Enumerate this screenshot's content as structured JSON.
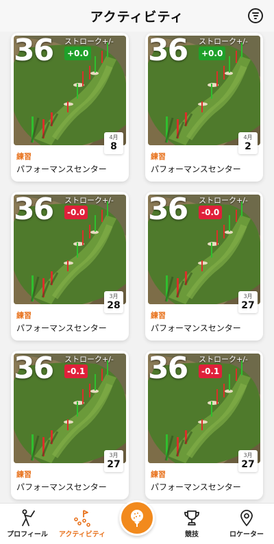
{
  "header": {
    "title": "アクティビティ",
    "menu_icon": "menu-circle-icon"
  },
  "stroke_label": "ストローク+/-",
  "cards": [
    {
      "score": "36",
      "diff": "+0.0",
      "diff_color": "#1fa02a",
      "month": "4月",
      "day": "8",
      "type": "練習",
      "venue": "パフォーマンスセンター"
    },
    {
      "score": "36",
      "diff": "+0.0",
      "diff_color": "#1fa02a",
      "month": "4月",
      "day": "2",
      "type": "練習",
      "venue": "パフォーマンスセンター"
    },
    {
      "score": "36",
      "diff": "-0.0",
      "diff_color": "#e0203a",
      "month": "3月",
      "day": "28",
      "type": "練習",
      "venue": "パフォーマンスセンター"
    },
    {
      "score": "36",
      "diff": "-0.0",
      "diff_color": "#e0203a",
      "month": "3月",
      "day": "27",
      "type": "練習",
      "venue": "パフォーマンスセンター"
    },
    {
      "score": "36",
      "diff": "-0.1",
      "diff_color": "#e0203a",
      "month": "3月",
      "day": "27",
      "type": "練習",
      "venue": "パフォーマンスセンター"
    },
    {
      "score": "36",
      "diff": "-0.1",
      "diff_color": "#e0203a",
      "month": "3月",
      "day": "27",
      "type": "練習",
      "venue": "パフォーマンスセンター"
    }
  ],
  "nav": {
    "profile": {
      "label": "プロフィール",
      "icon": "golfer-icon"
    },
    "activity": {
      "label": "アクティビティ",
      "icon": "activity-icon"
    },
    "play": {
      "icon": "golf-ball-tee-icon"
    },
    "compete": {
      "label": "競技",
      "icon": "trophy-icon"
    },
    "locator": {
      "label": "ロケーター",
      "icon": "location-pin-icon"
    }
  },
  "colors": {
    "accent": "#e8731e",
    "positive": "#1fa02a",
    "negative": "#e0203a"
  }
}
